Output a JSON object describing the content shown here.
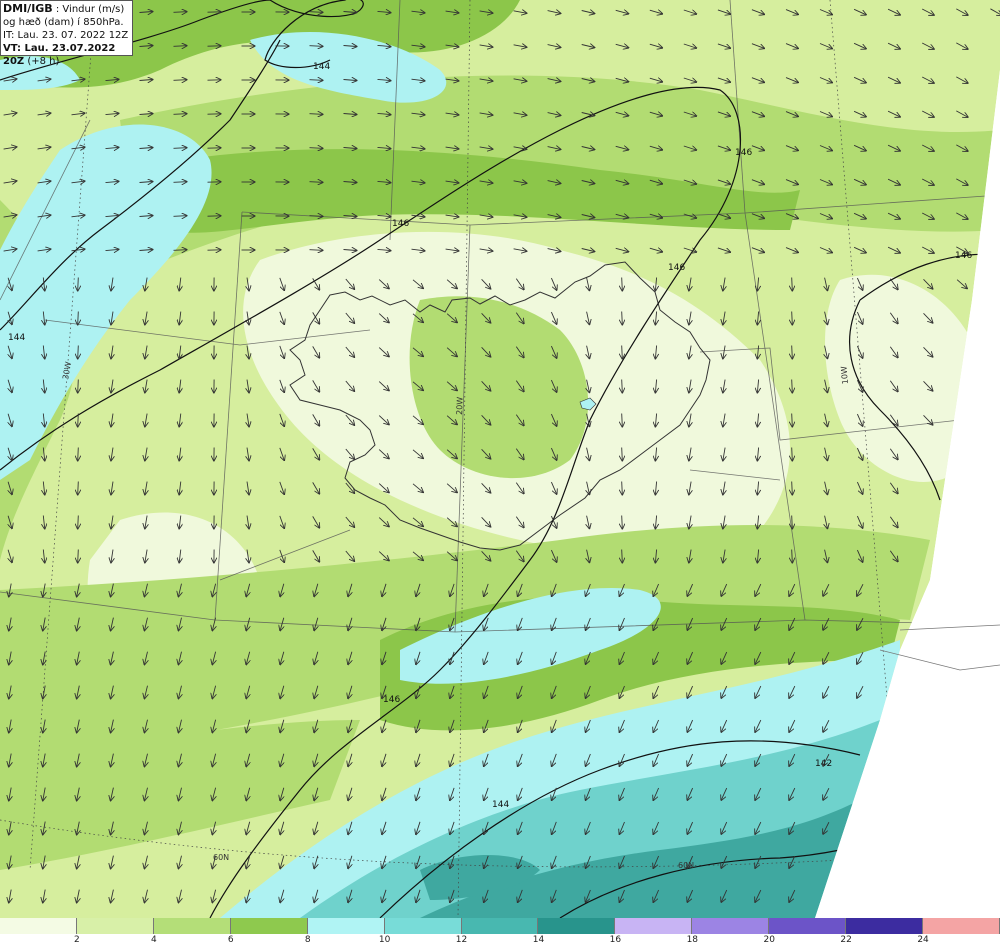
{
  "header": {
    "brand": "DMI/IGB",
    "variable": " : Vindur (m/s)",
    "height_line": "og hæð (dam) í 850hPa.",
    "initial_time": "IT: Lau. 23. 07. 2022 12Z",
    "valid_time": "VT: Lau. 23.07.2022 20Z",
    "lead": " (+8 h)"
  },
  "contour_labels": [
    "144",
    "146",
    "146",
    "146",
    "146",
    "144",
    "142",
    "144",
    "146"
  ],
  "grid_labels": [
    "30W",
    "20W",
    "10W",
    "60N",
    "60N"
  ],
  "legend": {
    "ticks": [
      "2",
      "4",
      "6",
      "8",
      "10",
      "12",
      "14",
      "16",
      "18",
      "20",
      "22",
      "24"
    ],
    "colors": [
      "#f4fbe4",
      "#d8f0a8",
      "#b4de78",
      "#8ec94e",
      "#b0f4f4",
      "#78dcd8",
      "#48b8b0",
      "#28948c",
      "#c8b4f4",
      "#9c84e4",
      "#6c54c8",
      "#3c2ca0",
      "#f4a4a4"
    ]
  },
  "colors": {
    "light": "#f0f9dc",
    "pale_green": "#d6ee9e",
    "green": "#b2dc72",
    "dark_green": "#8cc64a",
    "cyan": "#aef2f2",
    "teal": "#6fd2cc",
    "dark_teal": "#3fa8a0",
    "contour": "#111111",
    "grid": "#555555"
  }
}
